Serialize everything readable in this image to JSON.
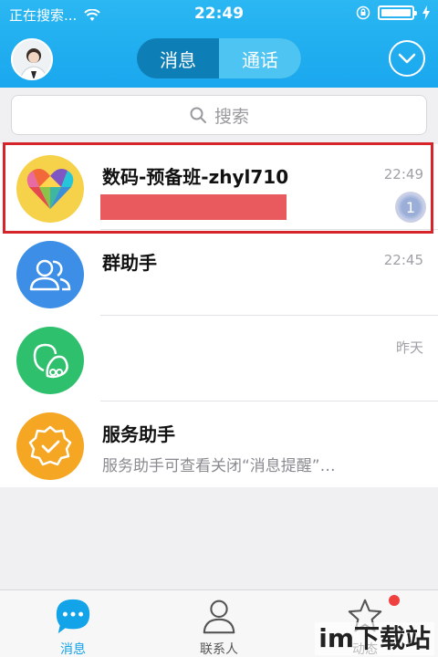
{
  "status_bar": {
    "carrier": "正在搜索...",
    "time": "22:49"
  },
  "nav": {
    "tabs": [
      {
        "label": "消息",
        "active": true
      },
      {
        "label": "通话",
        "active": false
      }
    ]
  },
  "search": {
    "placeholder": "搜索"
  },
  "conversations": [
    {
      "title": "数码-预备班-zhyl710",
      "time": "22:49",
      "preview": "",
      "unread": "1",
      "icon": "heart-logo-icon"
    },
    {
      "title": "群助手",
      "time": "22:45",
      "preview": "",
      "icon": "group-helper-icon"
    },
    {
      "title": "",
      "time": "昨天",
      "preview": "",
      "icon": "qq-friends-icon"
    },
    {
      "title": "服务助手",
      "time": "",
      "preview": "服务助手可查看关闭“消息提醒”…",
      "icon": "service-badge-icon"
    }
  ],
  "tabbar": {
    "items": [
      {
        "label": "消息",
        "icon": "message-bubble-icon"
      },
      {
        "label": "联系人",
        "icon": "contacts-icon"
      },
      {
        "label": "动态",
        "icon": "star-icon"
      }
    ]
  },
  "watermark": "im下载站",
  "colors": {
    "header": "#1aa7ee",
    "accent": "#12a3e8",
    "highlight": "#d6252a",
    "redact": "#e85a5e"
  }
}
